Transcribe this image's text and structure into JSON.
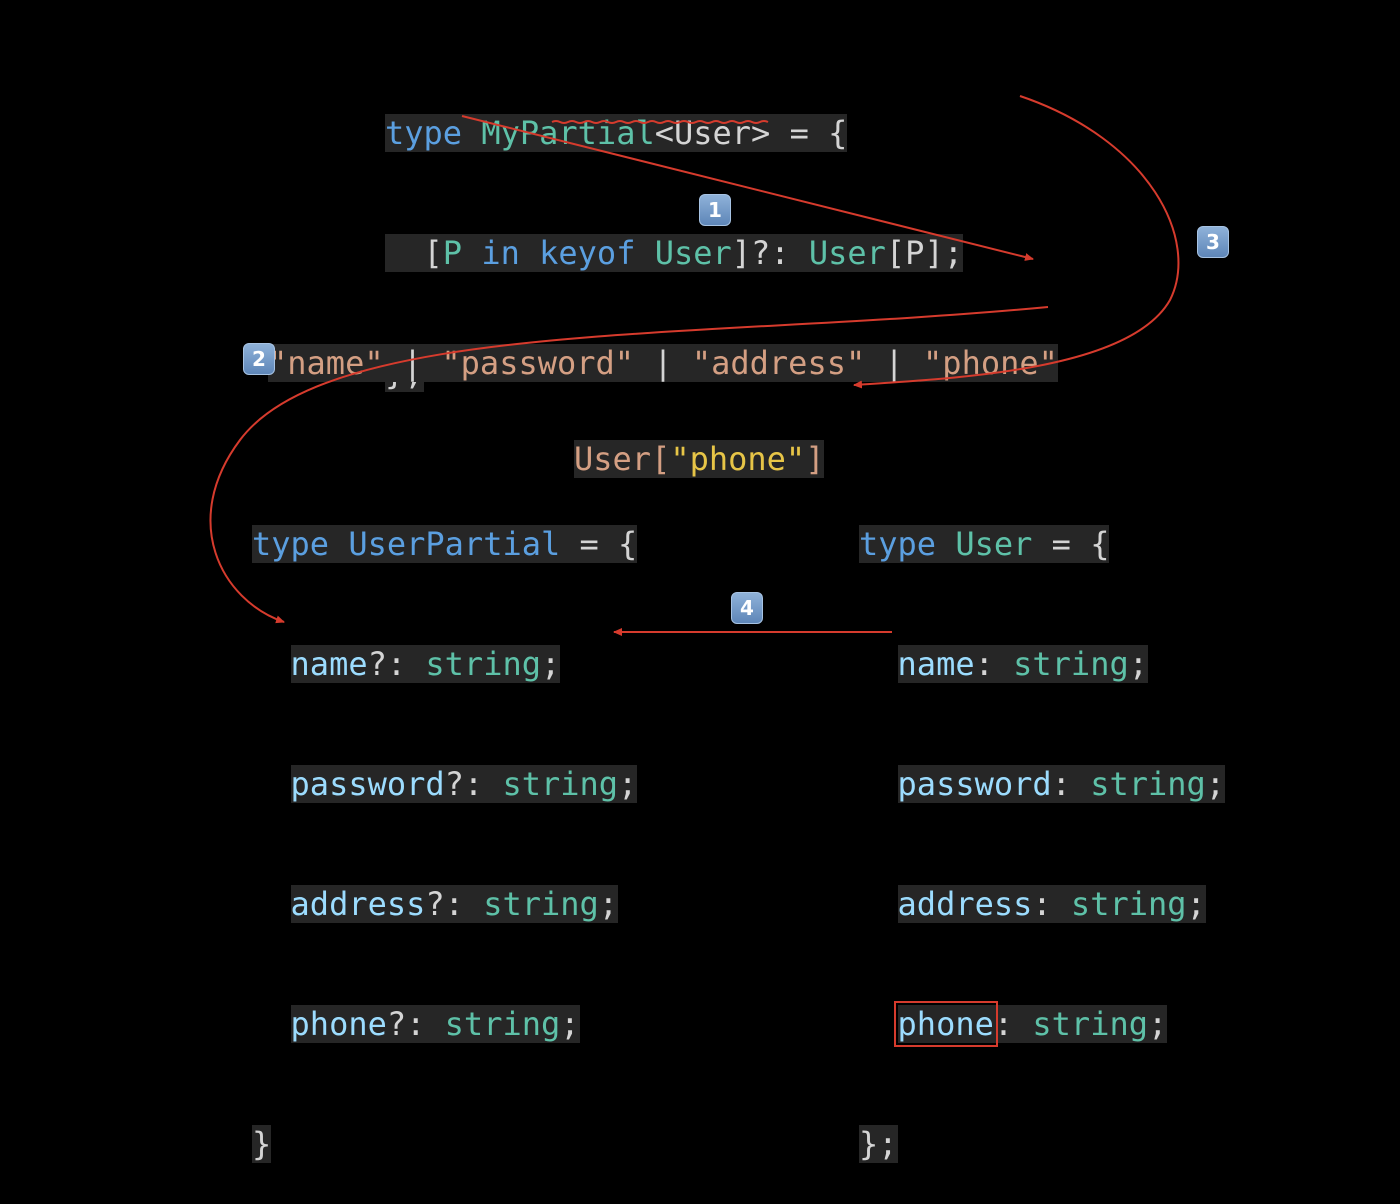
{
  "my_partial": {
    "line1": {
      "kw": "type",
      "name": "MyPartial",
      "rest": "<User> = {"
    },
    "line2": {
      "lead": "  [",
      "p": "P",
      "in": "in",
      "keyof": "keyof",
      "user": "User",
      "mid": "]?: ",
      "utype": "User",
      "idx": "[P];"
    },
    "line3": "};"
  },
  "union": {
    "parts": [
      "\"name\"",
      " | ",
      "\"password\"",
      " | ",
      "\"address\"",
      " | ",
      "\"phone\""
    ]
  },
  "indexed": {
    "head": "User[",
    "key": "\"phone\"",
    "tail": "]"
  },
  "user_partial": {
    "kw": "type",
    "name": "UserPartial",
    "open": " = {",
    "fields": [
      {
        "name": "name",
        "sep": "?: ",
        "type": "string",
        "end": ";"
      },
      {
        "name": "password",
        "sep": "?: ",
        "type": "string",
        "end": ";"
      },
      {
        "name": "address",
        "sep": "?: ",
        "type": "string",
        "end": ";"
      },
      {
        "name": "phone",
        "sep": "?: ",
        "type": "string",
        "end": ";"
      }
    ],
    "close": "}"
  },
  "user": {
    "kw": "type",
    "name": "User",
    "open": " = {",
    "fields": [
      {
        "name": "name",
        "sep": ": ",
        "type": "string",
        "end": ";"
      },
      {
        "name": "password",
        "sep": ": ",
        "type": "string",
        "end": ";"
      },
      {
        "name": "address",
        "sep": ": ",
        "type": "string",
        "end": ";"
      },
      {
        "name": "phone",
        "sep": ": ",
        "type": "string",
        "end": ";"
      }
    ],
    "close": "};"
  },
  "badges": [
    "1",
    "2",
    "3",
    "4"
  ],
  "colors": {
    "arrow": "#d63b2d",
    "keyword": "#5b9fe0",
    "type": "#5ec1a8",
    "property": "#9cdcfe",
    "string": "#d49f83",
    "highlight": "#e7c547"
  }
}
